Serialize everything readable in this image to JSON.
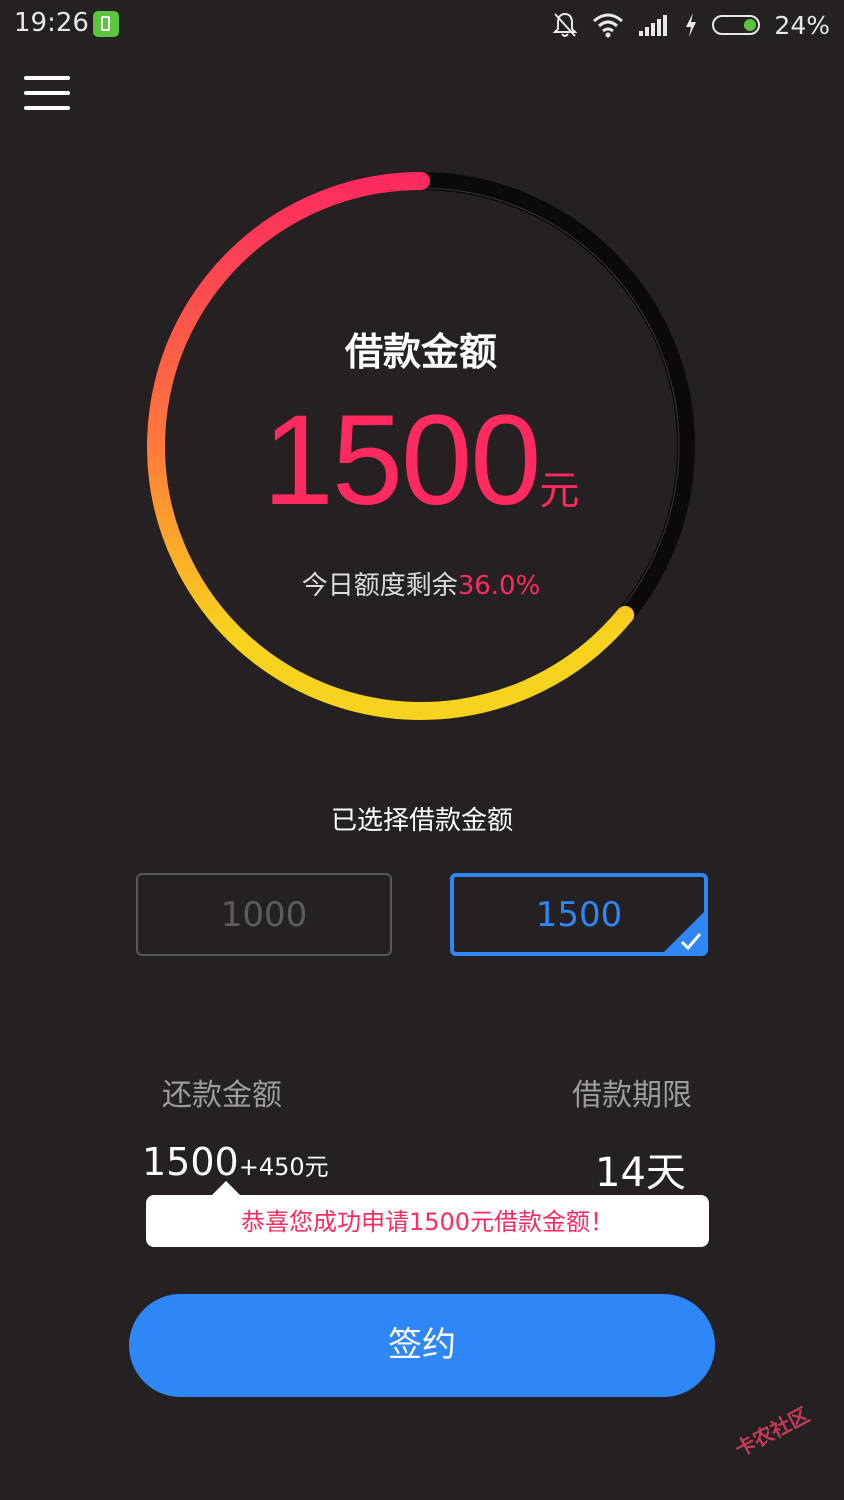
{
  "status_bar": {
    "time": "19:26",
    "battery_percent": "24%",
    "battery_level": 0.24
  },
  "gauge": {
    "title": "借款金额",
    "amount": "1500",
    "unit": "元",
    "remaining_label": "今日额度剩余",
    "remaining_value": "36.0%",
    "progress_fraction": 0.64,
    "colors": {
      "start": "#ff2a5f",
      "mid": "#ff7a3a",
      "end": "#f7d21e",
      "track": "#0a0a0a"
    }
  },
  "selection": {
    "label": "已选择借款金额",
    "options": [
      {
        "label": "1000",
        "selected": false
      },
      {
        "label": "1500",
        "selected": true
      }
    ]
  },
  "repayment": {
    "amount_label": "还款金额",
    "amount_value": "1500",
    "amount_extra": "+450元",
    "term_label": "借款期限",
    "term_value": "14天"
  },
  "toast": {
    "message": "恭喜您成功申请1500元借款金额！"
  },
  "sign_button": {
    "label": "签约"
  },
  "watermark": {
    "text": "卡农社区"
  },
  "colors": {
    "background": "#252122",
    "accent_blue": "#2f86f6",
    "accent_red": "#ff2a5f"
  }
}
